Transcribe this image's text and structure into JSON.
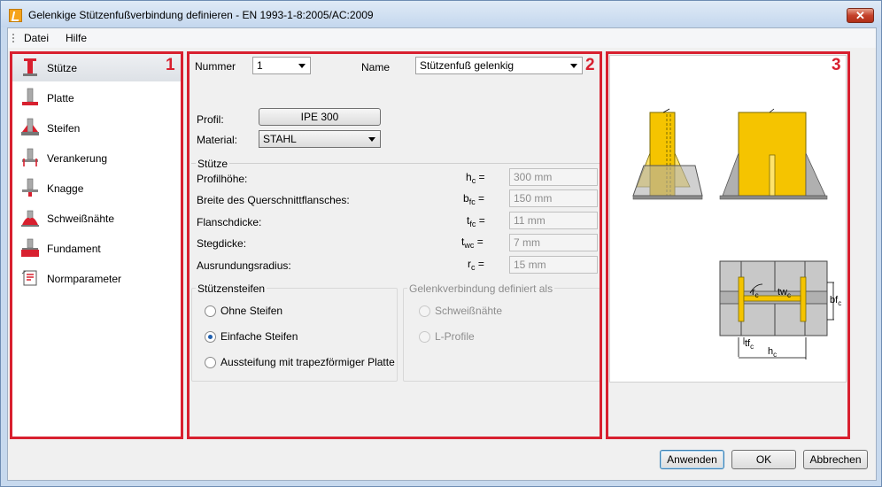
{
  "window": {
    "title": "Gelenkige Stützenfußverbindung definieren - EN 1993-1-8:2005/AC:2009",
    "close_label": "✕"
  },
  "menu": {
    "items": [
      "Datei",
      "Hilfe"
    ]
  },
  "badges": [
    "1",
    "2",
    "3"
  ],
  "nav": {
    "items": [
      {
        "label": "Stütze",
        "icon": "column-icon",
        "active": true
      },
      {
        "label": "Platte",
        "icon": "plate-icon"
      },
      {
        "label": "Steifen",
        "icon": "stiffener-icon"
      },
      {
        "label": "Verankerung",
        "icon": "anchor-icon"
      },
      {
        "label": "Knagge",
        "icon": "shear-key-icon"
      },
      {
        "label": "Schweißnähte",
        "icon": "weld-icon"
      },
      {
        "label": "Fundament",
        "icon": "foundation-icon"
      },
      {
        "label": "Normparameter",
        "icon": "code-parameters-icon"
      }
    ]
  },
  "form": {
    "nummer_label": "Nummer",
    "nummer_value": "1",
    "name_label": "Name",
    "name_value": "Stützenfuß gelenkig",
    "profil_label": "Profil:",
    "profil_value": "IPE 300",
    "material_label": "Material:",
    "material_value": "STAHL",
    "stuetze_group": "Stütze",
    "rows": [
      {
        "label": "Profilhöhe:",
        "sym": "h",
        "sub": "c",
        "value": "300 mm"
      },
      {
        "label": "Breite des Querschnittflansches:",
        "sym": "b",
        "sub": "fc",
        "value": "150 mm"
      },
      {
        "label": "Flanschdicke:",
        "sym": "t",
        "sub": "fc",
        "value": "11 mm"
      },
      {
        "label": "Stegdicke:",
        "sym": "t",
        "sub": "wc",
        "value": "7 mm"
      },
      {
        "label": "Ausrundungsradius:",
        "sym": "r",
        "sub": "c",
        "value": "15 mm"
      }
    ],
    "eq": "=",
    "steifen_group": "Stützensteifen",
    "steifen_options": [
      {
        "label": "Ohne Steifen",
        "checked": false
      },
      {
        "label": "Einfache Steifen",
        "checked": true
      },
      {
        "label": "Aussteifung mit trapezförmiger Platte",
        "checked": false
      }
    ],
    "gelenk_group": "Gelenkverbindung definiert als",
    "gelenk_options": [
      {
        "label": "Schweißnähte"
      },
      {
        "label": "L-Profile"
      }
    ]
  },
  "drawing": {
    "rc": "r",
    "rc_sub": "c",
    "twc": "tw",
    "twc_sub": "c",
    "bfc": "bf",
    "bfc_sub": "c",
    "tfc": "tf",
    "tfc_sub": "c",
    "hc": "h",
    "hc_sub": "c"
  },
  "footer": {
    "apply": "Anwenden",
    "ok": "OK",
    "cancel": "Abbrechen"
  },
  "colors": {
    "accent_red": "#d8202f",
    "steel_yellow": "#f5c400",
    "plate_grey": "#9a9a9a"
  }
}
